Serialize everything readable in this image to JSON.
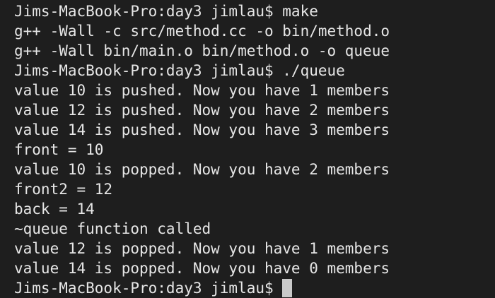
{
  "terminal": {
    "lines": [
      "Jims-MacBook-Pro:day3 jimlau$ make",
      "g++ -Wall -c src/method.cc -o bin/method.o",
      "g++ -Wall bin/main.o bin/method.o -o queue",
      "Jims-MacBook-Pro:day3 jimlau$ ./queue",
      "value 10 is pushed. Now you have 1 members",
      "value 12 is pushed. Now you have 2 members",
      "value 14 is pushed. Now you have 3 members",
      "front = 10",
      "value 10 is popped. Now you have 2 members",
      "front2 = 12",
      "back = 14",
      "~queue function called",
      "value 12 is popped. Now you have 1 members",
      "value 14 is popped. Now you have 0 members"
    ],
    "prompt": "Jims-MacBook-Pro:day3 jimlau$"
  },
  "colors": {
    "background": "#1e1e1e",
    "text": "#e6e6e6",
    "cursor": "#c9c9c9"
  }
}
